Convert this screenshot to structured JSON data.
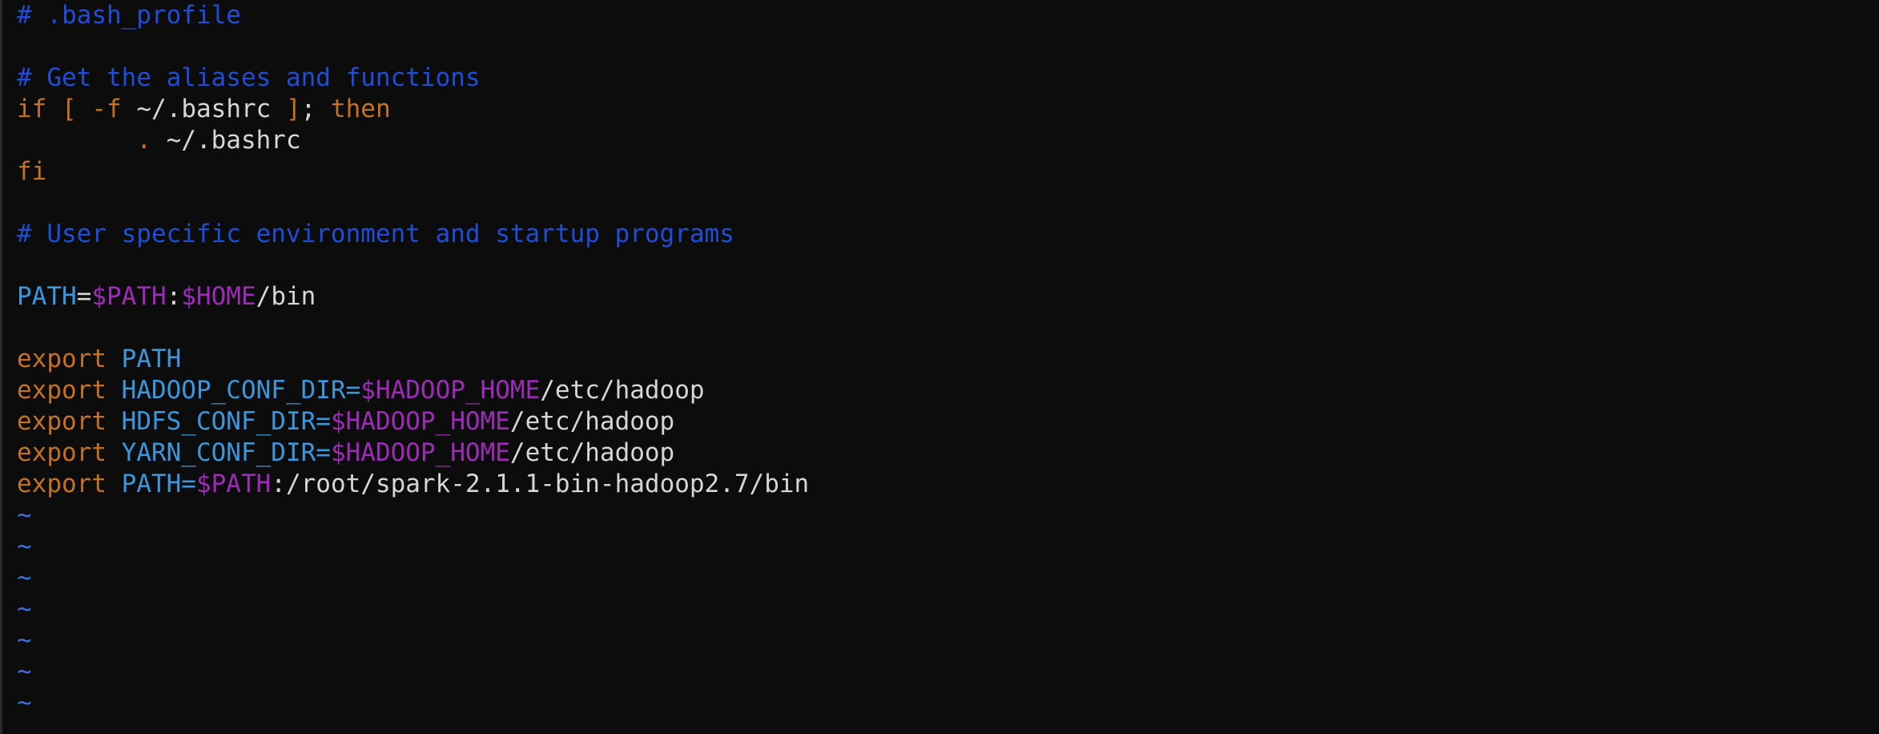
{
  "colors": {
    "background": "#0c0c0c",
    "comment": "#1f4dd6",
    "keyword": "#c4721e",
    "variable": "#3a96dd",
    "substitution": "#9e2bb8",
    "plain": "#d6d6d6",
    "tilde": "#3b6fe0"
  },
  "editor": {
    "lines": [
      [
        {
          "t": "# .bash_profile",
          "k": "comment"
        }
      ],
      [],
      [
        {
          "t": "# Get the aliases and functions",
          "k": "comment"
        }
      ],
      [
        {
          "t": "if",
          "k": "keyword"
        },
        {
          "t": " ",
          "k": "plain"
        },
        {
          "t": "[",
          "k": "keyword"
        },
        {
          "t": " ",
          "k": "plain"
        },
        {
          "t": "-f",
          "k": "keyword"
        },
        {
          "t": " ~/.bashrc ",
          "k": "plain"
        },
        {
          "t": "]",
          "k": "keyword"
        },
        {
          "t": "; ",
          "k": "plain"
        },
        {
          "t": "then",
          "k": "keyword"
        }
      ],
      [
        {
          "t": "        ",
          "k": "plain"
        },
        {
          "t": ".",
          "k": "keyword"
        },
        {
          "t": " ~/.bashrc",
          "k": "plain"
        }
      ],
      [
        {
          "t": "fi",
          "k": "keyword"
        }
      ],
      [],
      [
        {
          "t": "# User specific environment and startup programs",
          "k": "comment"
        }
      ],
      [],
      [
        {
          "t": "PATH",
          "k": "variable"
        },
        {
          "t": "=",
          "k": "plain"
        },
        {
          "t": "$PATH",
          "k": "substitution"
        },
        {
          "t": ":",
          "k": "plain"
        },
        {
          "t": "$HOME",
          "k": "substitution"
        },
        {
          "t": "/bin",
          "k": "plain"
        }
      ],
      [],
      [
        {
          "t": "export",
          "k": "keyword"
        },
        {
          "t": " ",
          "k": "plain"
        },
        {
          "t": "PATH",
          "k": "variable"
        }
      ],
      [
        {
          "t": "export",
          "k": "keyword"
        },
        {
          "t": " ",
          "k": "plain"
        },
        {
          "t": "HADOOP_CONF_DIR=",
          "k": "variable"
        },
        {
          "t": "$HADOOP_HOME",
          "k": "substitution"
        },
        {
          "t": "/etc/hadoop",
          "k": "plain"
        }
      ],
      [
        {
          "t": "export",
          "k": "keyword"
        },
        {
          "t": " ",
          "k": "plain"
        },
        {
          "t": "HDFS_CONF_DIR=",
          "k": "variable"
        },
        {
          "t": "$HADOOP_HOME",
          "k": "substitution"
        },
        {
          "t": "/etc/hadoop",
          "k": "plain"
        }
      ],
      [
        {
          "t": "export",
          "k": "keyword"
        },
        {
          "t": " ",
          "k": "plain"
        },
        {
          "t": "YARN_CONF_DIR=",
          "k": "variable"
        },
        {
          "t": "$HADOOP_HOME",
          "k": "substitution"
        },
        {
          "t": "/etc/hadoop",
          "k": "plain"
        }
      ],
      [
        {
          "t": "export",
          "k": "keyword"
        },
        {
          "t": " ",
          "k": "plain"
        },
        {
          "t": "PATH=",
          "k": "variable"
        },
        {
          "t": "$PATH",
          "k": "substitution"
        },
        {
          "t": ":/root/spark-2.1.1-bin-hadoop2.7/bin",
          "k": "plain"
        }
      ],
      [
        {
          "t": "~",
          "k": "tilde"
        }
      ],
      [
        {
          "t": "~",
          "k": "tilde"
        }
      ],
      [
        {
          "t": "~",
          "k": "tilde"
        }
      ],
      [
        {
          "t": "~",
          "k": "tilde"
        }
      ],
      [
        {
          "t": "~",
          "k": "tilde"
        }
      ],
      [
        {
          "t": "~",
          "k": "tilde"
        }
      ],
      [
        {
          "t": "~",
          "k": "tilde"
        }
      ]
    ]
  }
}
